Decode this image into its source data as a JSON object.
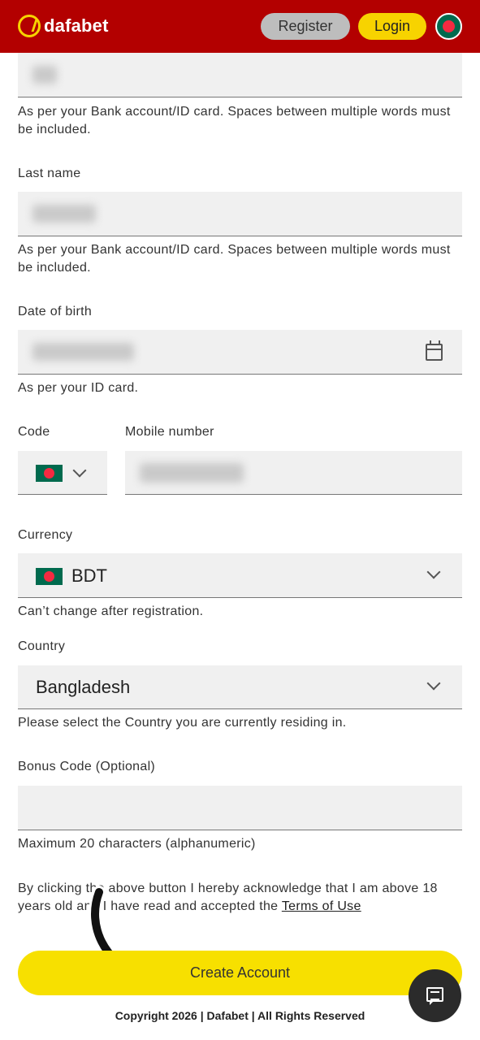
{
  "header": {
    "brand": "dafabet",
    "register_label": "Register",
    "login_label": "Login"
  },
  "form": {
    "first_name_hint": "As per your Bank account/ID card. Spaces between multiple words must be included.",
    "last_name_label": "Last name",
    "last_name_hint": "As per your Bank account/ID card. Spaces between multiple words must be included.",
    "dob_label": "Date of birth",
    "dob_hint": "As per your ID card.",
    "code_label": "Code",
    "mobile_label": "Mobile number",
    "currency_label": "Currency",
    "currency_value": "BDT",
    "currency_hint": "Can’t change after registration.",
    "country_label": "Country",
    "country_value": "Bangladesh",
    "country_hint": "Please select the Country you are currently residing in.",
    "bonus_label": "Bonus Code (Optional)",
    "bonus_value": "",
    "bonus_hint": "Maximum 20 characters (alphanumeric)",
    "terms_prefix": "By clicking the above button I hereby acknowledge that I am above 18 years old and I have read and accepted the ",
    "terms_link": "Terms of Use",
    "submit_label": "Create Account"
  },
  "footer": {
    "copyright": "Copyright 2026 | Dafabet | All Rights Reserved"
  },
  "colors": {
    "header_bg": "#b30000",
    "accent_yellow": "#f7d300",
    "button_yellow": "#f7e000",
    "field_bg": "#f0f0f0"
  },
  "icons": [
    "dafabet-logo-icon",
    "bangladesh-flag-icon",
    "calendar-icon",
    "chevron-down-icon",
    "chat-icon",
    "arrow-pointer-icon"
  ]
}
